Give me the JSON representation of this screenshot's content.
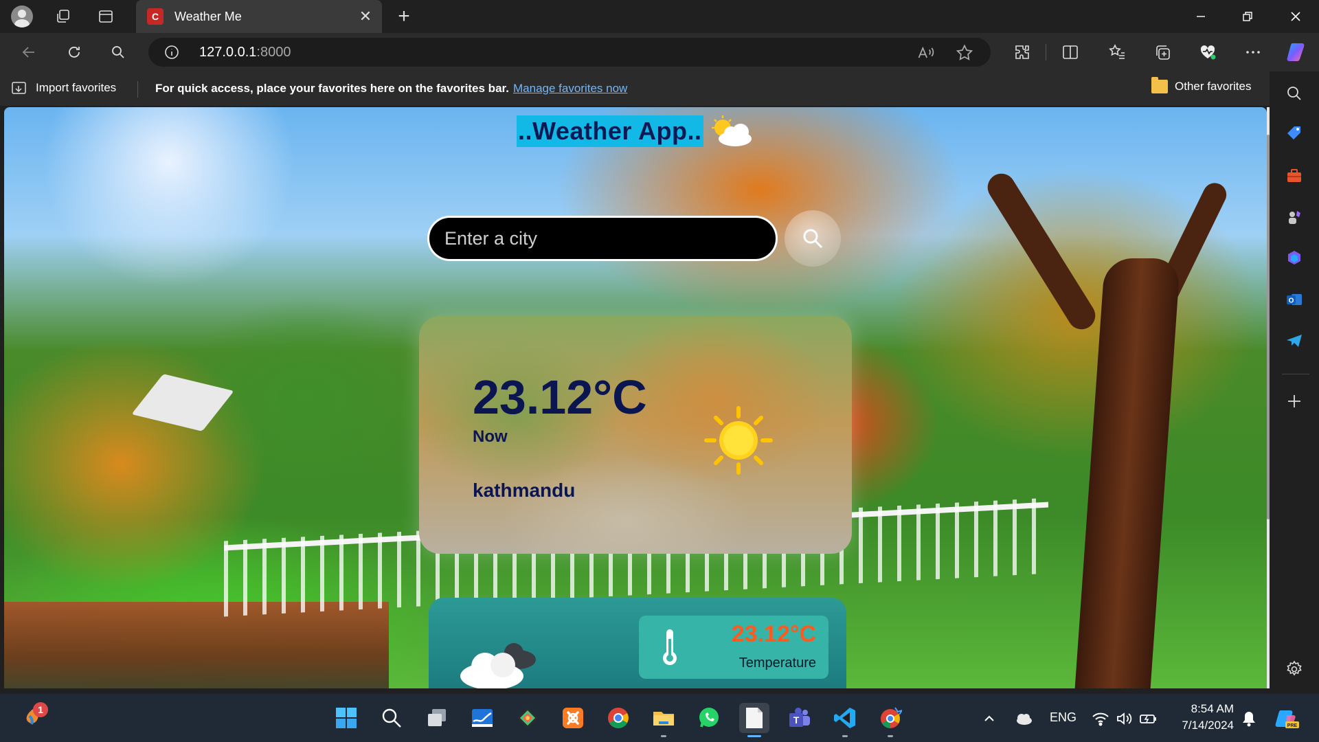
{
  "browser": {
    "tab_title": "Weather Me",
    "tab_favicon_letter": "C",
    "url_host": "127.0.0.1",
    "url_port": ":8000",
    "accent": "#12b8e6"
  },
  "favorites_bar": {
    "import_label": "Import favorites",
    "tip": "For quick access, place your favorites here on the favorites bar.",
    "manage_link": "Manage favorites now",
    "other_label": "Other favorites"
  },
  "app": {
    "title": "..Weather App..",
    "search_placeholder": "Enter a city",
    "current": {
      "temperature": "23.12°C",
      "now_label": "Now",
      "city": "kathmandu"
    },
    "details": {
      "temperature_value": "23.12°C",
      "temperature_label": "Temperature"
    }
  },
  "taskbar": {
    "notification_count": "1",
    "language": "ENG",
    "time": "8:54 AM",
    "date": "7/14/2024"
  }
}
